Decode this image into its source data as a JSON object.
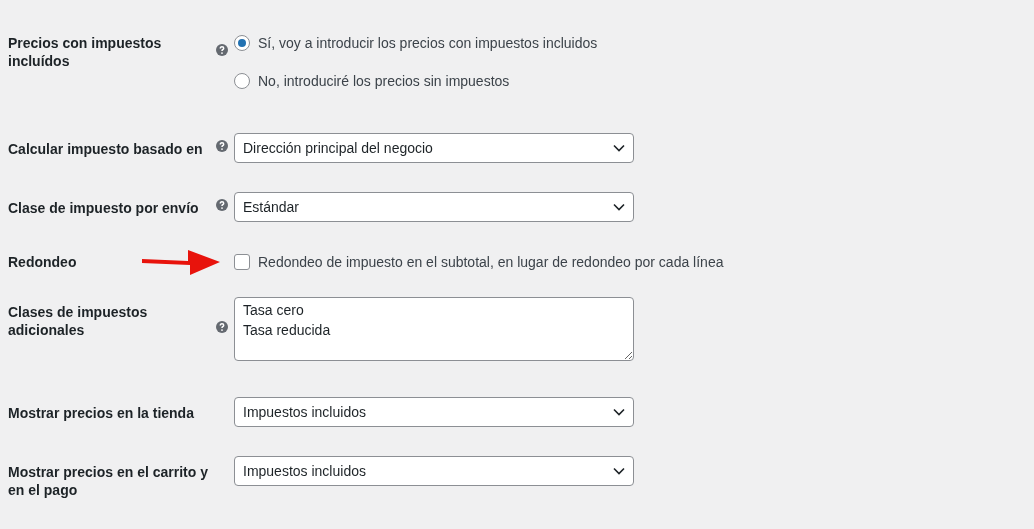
{
  "settings": [
    {
      "kind": "radio",
      "label": "Precios con impuestos incluídos",
      "help": true,
      "options": [
        {
          "label": "Sí, voy a introducir los precios con impuestos incluidos",
          "selected": true
        },
        {
          "label": "No, introduciré los precios sin impuestos",
          "selected": false
        }
      ]
    },
    {
      "kind": "select",
      "label": "Calcular impuesto basado en",
      "help": true,
      "value": "Dirección principal del negocio"
    },
    {
      "kind": "select",
      "label": "Clase de impuesto por envío",
      "help": true,
      "value": "Estándar"
    },
    {
      "kind": "checkbox",
      "label": "Redondeo",
      "help": false,
      "arrow": true,
      "text": "Redondeo de impuesto en el subtotal, en lugar de redondeo por cada línea",
      "checked": false
    },
    {
      "kind": "textarea",
      "label": "Clases de impuestos adicionales",
      "help": true,
      "lines": [
        "Tasa cero",
        "Tasa reducida"
      ]
    },
    {
      "kind": "select",
      "label": "Mostrar precios en la tienda",
      "help": false,
      "value": "Impuestos incluidos"
    },
    {
      "kind": "select",
      "label": "Mostrar precios en el carrito y en el pago",
      "help": false,
      "value": "Impuestos incluidos"
    }
  ]
}
